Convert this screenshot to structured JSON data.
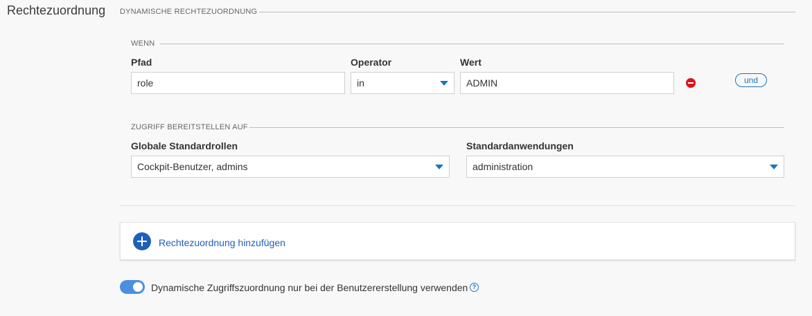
{
  "section": {
    "title": "Rechtezuordnung"
  },
  "dynamic": {
    "title": "DYNAMISCHE RECHTEZUORDNUNG",
    "when": {
      "title": "WENN",
      "path_label": "Pfad",
      "path_value": "role",
      "operator_label": "Operator",
      "operator_value": "in",
      "value_label": "Wert",
      "value_value": "ADMIN",
      "and_label": "und"
    },
    "grant": {
      "title": "ZUGRIFF BEREITSTELLEN AUF",
      "roles_label": "Globale Standardrollen",
      "roles_value": "Cockpit-Benutzer, admins",
      "apps_label": "Standardanwendungen",
      "apps_value": "administration"
    }
  },
  "add_mapping": {
    "label": "Rechtezuordnung hinzufügen"
  },
  "toggle": {
    "label": "Dynamische Zugriffszuordnung nur bei der Benutzererstellung verwenden",
    "checked": true,
    "help_glyph": "?"
  },
  "colors": {
    "accent": "#1776bf",
    "danger": "#e0131a",
    "toggle_on": "#4a8fe0"
  }
}
